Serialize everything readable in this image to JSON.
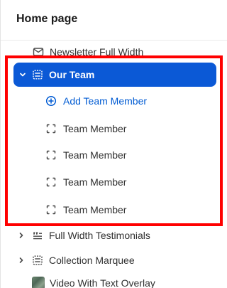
{
  "header": {
    "title": "Home page"
  },
  "items": {
    "newsletter": {
      "label": "Newsletter Full Width",
      "icon": "mail-icon"
    },
    "our_team": {
      "label": "Our Team",
      "icon": "section-icon",
      "chevron": "chevron-down-icon"
    },
    "add_team_member": {
      "label": "Add Team Member",
      "icon": "plus-circle-icon"
    },
    "team_members": [
      {
        "label": "Team Member",
        "icon": "block-icon"
      },
      {
        "label": "Team Member",
        "icon": "block-icon"
      },
      {
        "label": "Team Member",
        "icon": "block-icon"
      },
      {
        "label": "Team Member",
        "icon": "block-icon"
      }
    ],
    "full_width_testimonials": {
      "label": "Full Width Testimonials",
      "icon": "quote-list-icon",
      "chevron": "chevron-right-icon"
    },
    "collection_marquee": {
      "label": "Collection Marquee",
      "icon": "section-icon",
      "chevron": "chevron-right-icon"
    },
    "video_with_text_overlay": {
      "label": "Video With Text Overlay",
      "icon": "video-thumbnail-icon"
    }
  },
  "colors": {
    "selected_bg": "#0b59d6",
    "highlight_border": "#ff0000",
    "link_blue": "#005bd3"
  }
}
